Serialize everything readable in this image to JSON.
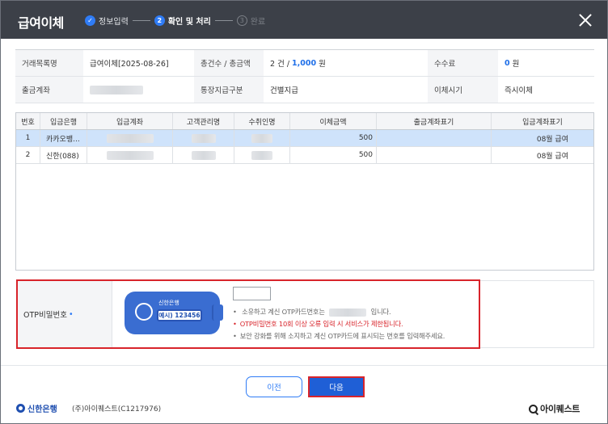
{
  "header": {
    "title": "급여이체",
    "steps": [
      {
        "num": "✓",
        "label": "정보입력",
        "state": "done"
      },
      {
        "num": "2",
        "label": "확인 및 처리",
        "state": "active"
      },
      {
        "num": "3",
        "label": "완료",
        "state": "pending"
      }
    ],
    "close_icon": "close-icon"
  },
  "info": {
    "trade_name_label": "거래목록명",
    "trade_name_value": "급여이체[2025-08-26]",
    "total_label": "총건수 / 총금액",
    "total_count": "2 건 /",
    "total_amount": "1,000",
    "total_unit": "원",
    "fee_label": "수수료",
    "fee_value": "0",
    "fee_unit": "원",
    "account_label": "출금계좌",
    "account_value": "",
    "payout_type_label": "통장지급구분",
    "payout_type_value": "건별지급",
    "transfer_time_label": "이체시기",
    "transfer_time_value": "즉시이체"
  },
  "grid": {
    "columns": [
      "번호",
      "입금은행",
      "입금계좌",
      "고객관리명",
      "수취인명",
      "이체금액",
      "출금계좌표기",
      "입금계좌표기"
    ],
    "rows": [
      {
        "no": "1",
        "bank": "카카오뱅...",
        "account": "",
        "customer": "",
        "recipient": "",
        "amount": "500",
        "out_memo": "",
        "in_memo": "08월 급여"
      },
      {
        "no": "2",
        "bank": "신한(088)",
        "account": "",
        "customer": "",
        "recipient": "",
        "amount": "500",
        "out_memo": "",
        "in_memo": "08월 급여"
      }
    ]
  },
  "otp": {
    "label": "OTP비밀번호",
    "required_mark": "•",
    "card_brand": "신한은행",
    "card_example": "예시) 123456",
    "input_value": "",
    "note1_pre": "소유하고 계신 OTP카드번호는",
    "note1_post": "입니다.",
    "note2": "OTP비밀번호 10회 이상 오류 입력 시 서비스가 제한됩니다.",
    "note3": "보안 강화를 위해 소지하고 계신 OTP카드에 표시되는 번호를 입력해주세요."
  },
  "footer": {
    "prev_label": "이전",
    "next_label": "다음",
    "bank_name": "신한은행",
    "company": "(주)아이퀘스트(C1217976)",
    "brand": "아이퀘스트"
  },
  "colors": {
    "header_bg": "#3c4048",
    "accent_blue": "#2f7cf6",
    "highlight_red": "#d8242b",
    "selected_row": "#cfe3fb"
  }
}
